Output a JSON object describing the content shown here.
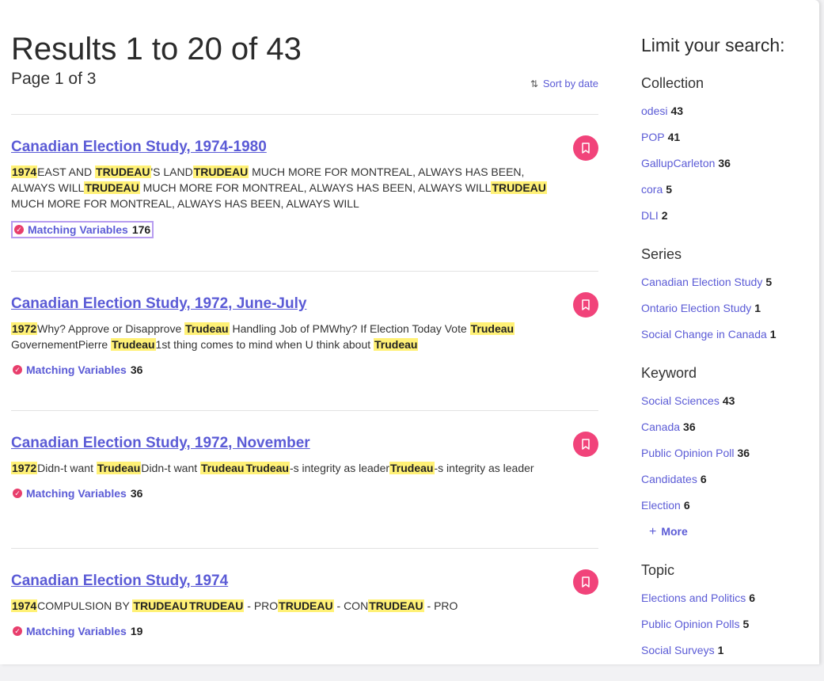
{
  "header": {
    "results_title": "Results 1 to 20 of 43",
    "page_info": "Page 1 of 3",
    "sort_label": "Sort by date"
  },
  "results": [
    {
      "title": "Canadian Election Study, 1974-1980",
      "snippet": [
        {
          "text": "1974",
          "hl": true
        },
        {
          "text": "EAST AND ",
          "hl": false
        },
        {
          "text": "TRUDEAU",
          "hl": true
        },
        {
          "text": "'S LAND",
          "hl": false
        },
        {
          "text": "TRUDEAU",
          "hl": true
        },
        {
          "text": " MUCH MORE FOR MONTREAL, ALWAYS HAS BEEN, ALWAYS WILL",
          "hl": false
        },
        {
          "text": "TRUDEAU",
          "hl": true
        },
        {
          "text": " MUCH MORE FOR MONTREAL, ALWAYS HAS BEEN, ALWAYS WILL",
          "hl": false
        },
        {
          "text": "TRUDEAU",
          "hl": true
        },
        {
          "text": " MUCH MORE FOR MONTREAL, ALWAYS HAS BEEN, ALWAYS WILL",
          "hl": false
        }
      ],
      "matching_label": "Matching Variables",
      "matching_count": "176",
      "focused": true
    },
    {
      "title": "Canadian Election Study, 1972, June-July",
      "snippet": [
        {
          "text": "1972",
          "hl": true
        },
        {
          "text": "Why? Approve or Disapprove ",
          "hl": false
        },
        {
          "text": "Trudeau",
          "hl": true
        },
        {
          "text": " Handling Job of PMWhy? If Election Today Vote ",
          "hl": false
        },
        {
          "text": "Trudeau",
          "hl": true
        },
        {
          "text": " GovernementPierre ",
          "hl": false
        },
        {
          "text": "Trudeau",
          "hl": true
        },
        {
          "text": "1st thing comes to mind when U think about ",
          "hl": false
        },
        {
          "text": "Trudeau",
          "hl": true
        }
      ],
      "matching_label": "Matching Variables",
      "matching_count": "36",
      "focused": false
    },
    {
      "title": "Canadian Election Study, 1972, November",
      "snippet": [
        {
          "text": "1972",
          "hl": true
        },
        {
          "text": "Didn-t want ",
          "hl": false
        },
        {
          "text": "Trudeau",
          "hl": true
        },
        {
          "text": "Didn-t want ",
          "hl": false
        },
        {
          "text": "Trudeau",
          "hl": true
        },
        {
          "text": "Trudeau",
          "hl": true
        },
        {
          "text": "-s integrity as leader",
          "hl": false
        },
        {
          "text": "Trudeau",
          "hl": true
        },
        {
          "text": "-s integrity as leader",
          "hl": false
        }
      ],
      "matching_label": "Matching Variables",
      "matching_count": "36",
      "focused": false
    },
    {
      "title": "Canadian Election Study, 1974",
      "snippet": [
        {
          "text": "1974",
          "hl": true
        },
        {
          "text": "COMPULSION BY ",
          "hl": false
        },
        {
          "text": "TRUDEAU",
          "hl": true
        },
        {
          "text": "TRUDEAU",
          "hl": true
        },
        {
          "text": " - PRO",
          "hl": false
        },
        {
          "text": "TRUDEAU",
          "hl": true
        },
        {
          "text": " - CON",
          "hl": false
        },
        {
          "text": "TRUDEAU",
          "hl": true
        },
        {
          "text": " - PRO",
          "hl": false
        }
      ],
      "matching_label": "Matching Variables",
      "matching_count": "19",
      "focused": false
    }
  ],
  "sidebar": {
    "title": "Limit your search:",
    "facets": [
      {
        "heading": "Collection",
        "items": [
          {
            "label": "odesi",
            "count": "43"
          },
          {
            "label": "POP",
            "count": "41"
          },
          {
            "label": "GallupCarleton",
            "count": "36"
          },
          {
            "label": "cora",
            "count": "5"
          },
          {
            "label": "DLI",
            "count": "2"
          }
        ]
      },
      {
        "heading": "Series",
        "items": [
          {
            "label": "Canadian Election Study",
            "count": "5"
          },
          {
            "label": "Ontario Election Study",
            "count": "1"
          },
          {
            "label": "Social Change in Canada",
            "count": "1"
          }
        ]
      },
      {
        "heading": "Keyword",
        "items": [
          {
            "label": "Social Sciences",
            "count": "43"
          },
          {
            "label": "Canada",
            "count": "36"
          },
          {
            "label": "Public Opinion Poll",
            "count": "36"
          },
          {
            "label": "Candidates",
            "count": "6"
          },
          {
            "label": "Election",
            "count": "6"
          }
        ],
        "more_label": "More"
      },
      {
        "heading": "Topic",
        "items": [
          {
            "label": "Elections and Politics",
            "count": "6"
          },
          {
            "label": "Public Opinion Polls",
            "count": "5"
          },
          {
            "label": "Social Surveys",
            "count": "1"
          }
        ]
      }
    ]
  },
  "colors": {
    "link": "#5b5bd6",
    "highlight": "#fff176",
    "bookmark": "#f1437a",
    "check": "#e83e6c",
    "focus": "#b79cf0"
  },
  "icons": {
    "sort": "sort-arrows-icon",
    "bookmark": "bookmark-icon",
    "check": "check-circle-icon",
    "plus": "plus-icon"
  }
}
